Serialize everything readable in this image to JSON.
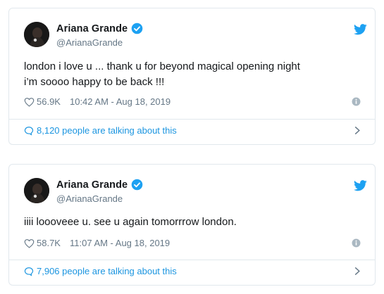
{
  "colors": {
    "accent": "#1da1f2",
    "link": "#1b95e0",
    "muted": "#657786",
    "text": "#14171a",
    "border": "#e1e8ed"
  },
  "icons": {
    "verified": "verified-badge-icon",
    "logo": "twitter-bird-icon",
    "like": "heart-icon",
    "info": "info-icon",
    "reply": "speech-bubble-icon",
    "expand": "chevron-right-icon"
  },
  "tweets": [
    {
      "name": "Ariana Grande",
      "handle": "@ArianaGrande",
      "text_lines": [
        "london i love u ... thank u for beyond magical opening night",
        "i’m soooo happy to be back !!!"
      ],
      "likes": "56.9K",
      "timestamp": "10:42 AM - Aug 18, 2019",
      "talking": "8,120 people are talking about this"
    },
    {
      "name": "Ariana Grande",
      "handle": "@ArianaGrande",
      "text_lines": [
        "iiii loooveee u. see u again tomorrrow london."
      ],
      "likes": "58.7K",
      "timestamp": "11:07 AM - Aug 18, 2019",
      "talking": "7,906 people are talking about this"
    }
  ]
}
